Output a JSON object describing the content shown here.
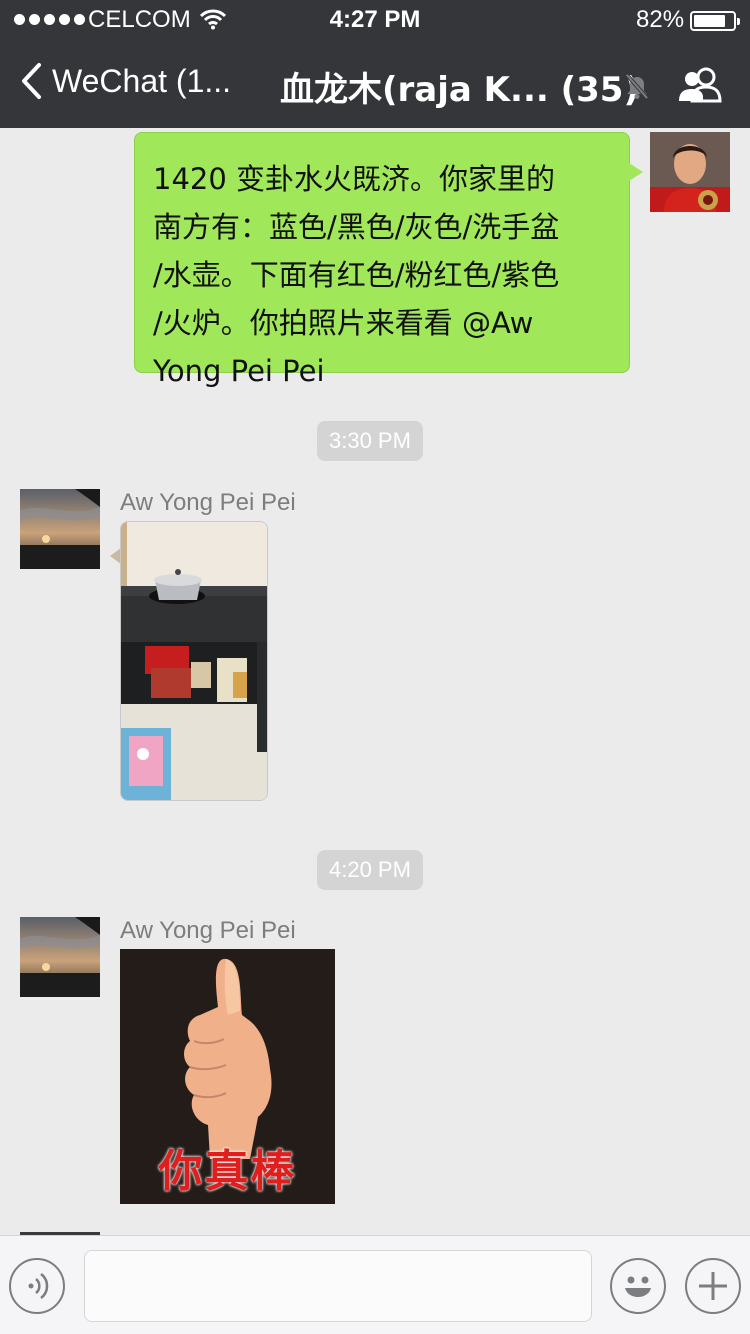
{
  "status_bar": {
    "carrier": "CELCOM",
    "time": "4:27 PM",
    "battery": "82%",
    "battery_level": 0.82,
    "signal_bars": 5
  },
  "nav": {
    "back_label": "WeChat (1...",
    "title": "血龙木(raja K... (35)",
    "icons": [
      "chevron-left-icon",
      "mute-bell-icon",
      "group-members-icon"
    ]
  },
  "messages": [
    {
      "type": "text",
      "outgoing": true,
      "lines": [
        "1420 变卦水火既济。你家里的",
        "南方有：蓝色/黑色/灰色/洗手盆",
        "/水壶。下面有红色/粉红色/紫色",
        "/火炉。你拍照片来看看 @Aw",
        "Yong Pei Pei"
      ]
    },
    {
      "type": "time",
      "text": "3:30 PM"
    },
    {
      "type": "image",
      "sender": "Aw Yong Pei Pei",
      "content": "kitchen stove photo"
    },
    {
      "type": "time",
      "text": "4:20 PM"
    },
    {
      "type": "sticker",
      "sender": "Aw Yong Pei Pei",
      "caption": "你真棒"
    }
  ],
  "input_bar": {
    "placeholder": "",
    "icons": [
      "voice-icon",
      "emoji-icon",
      "plus-icon"
    ]
  },
  "colors": {
    "nav_bg": "#35363a",
    "chat_bg": "#ebebeb",
    "outgoing_bubble": "#a0e75a",
    "time_pill": "#d4d4d4",
    "sticker_text": "#e01e1e"
  }
}
